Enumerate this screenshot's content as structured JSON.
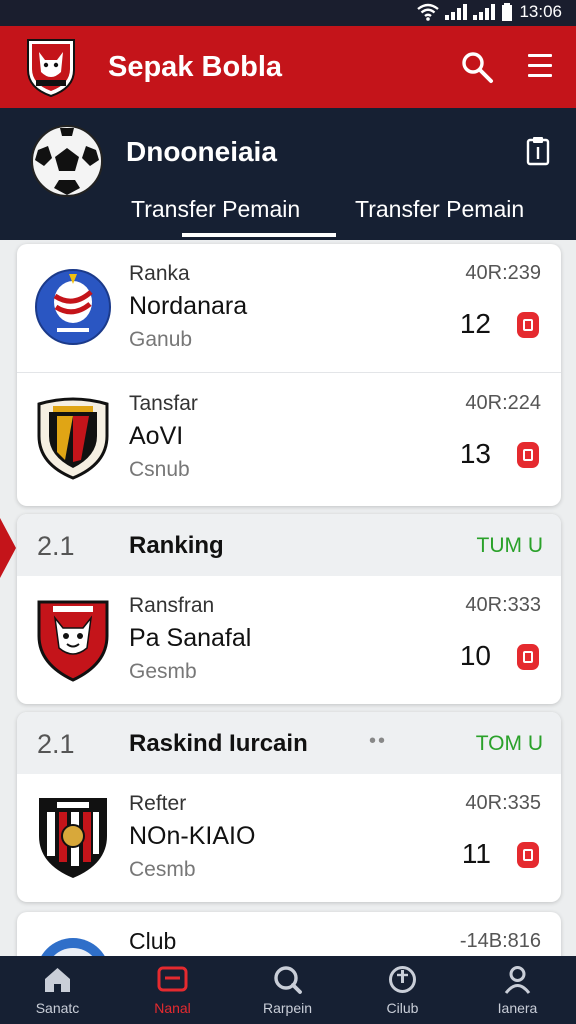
{
  "status_bar": {
    "time": "13:06"
  },
  "app_bar": {
    "title": "Sepak Bobla"
  },
  "header": {
    "title": "Dnooneiaia",
    "tabs": [
      {
        "label": "Transfer  Pemain"
      },
      {
        "label": "Transfer  Pemain"
      }
    ]
  },
  "cards": [
    {
      "rows": [
        {
          "top": "Ranka",
          "name": "Nordanara",
          "sub": "Ganub",
          "meta": "40R:239",
          "number": "12",
          "crest": "globe-crest-icon"
        },
        {
          "top": "Tansfar",
          "name": "AoVI",
          "sub": "Csnub",
          "meta": "40R:224",
          "number": "13",
          "crest": "striped-shield-crest-icon"
        }
      ]
    },
    {
      "section": {
        "num": "2.1",
        "title": "Ranking",
        "tag": "TUM U"
      },
      "rows": [
        {
          "top": "Ransfran",
          "name": "Pa  Sanafal",
          "sub": "Gesmb",
          "meta": "40R:333",
          "number": "10",
          "crest": "red-shield-crest-icon"
        }
      ]
    },
    {
      "section": {
        "num": "2.1",
        "title": "Raskind Iurcain",
        "dots": "••",
        "tag": "TOM U"
      },
      "rows": [
        {
          "top": "Refter",
          "name": "NOn-KIAIO",
          "sub": "Cesmb",
          "meta": "40R:335",
          "number": "11",
          "crest": "black-striped-crest-icon"
        }
      ]
    },
    {
      "rows": [
        {
          "top": "Club",
          "meta": "-14B:816",
          "crest": "blue-club-crest-icon"
        }
      ]
    }
  ],
  "bottom_nav": [
    {
      "label": "Sanatc",
      "icon": "home-icon",
      "active": false
    },
    {
      "label": "Nanal",
      "icon": "news-icon",
      "active": true
    },
    {
      "label": "Rarpein",
      "icon": "search-icon",
      "active": false
    },
    {
      "label": "Cilub",
      "icon": "club-icon",
      "active": false
    },
    {
      "label": "Ianera",
      "icon": "profile-icon",
      "active": false
    }
  ],
  "colors": {
    "brand_red": "#c4141a",
    "dark_navy": "#162033",
    "accent_green": "#2aa12a",
    "badge_red": "#e52a2f"
  }
}
